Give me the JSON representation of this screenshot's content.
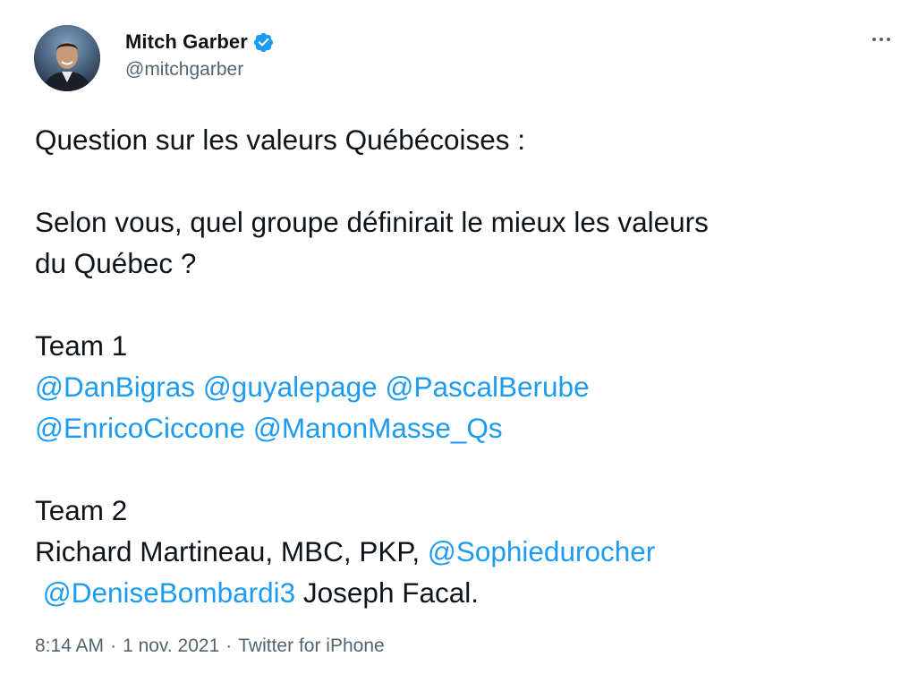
{
  "author": {
    "display_name": "Mitch Garber",
    "handle": "@mitchgarber",
    "verified": true
  },
  "tweet": {
    "line1": "Question sur les valeurs Québécoises :",
    "line2": "Selon vous, quel groupe définirait le mieux les valeurs",
    "line3": "du Québec ?",
    "team1_title": "Team 1",
    "team1_mentions_row1": [
      "@DanBigras",
      "@guyalepage",
      "@PascalBerube"
    ],
    "team1_mentions_row2": [
      "@EnricoCiccone",
      "@ManonMasse_Qs"
    ],
    "team2_title": "Team 2",
    "team2_row1_text": "Richard Martineau, MBC, PKP, ",
    "team2_row1_mention": "@Sophiedurocher",
    "team2_row2_mention": "@DeniseBombardi3",
    "team2_row2_text": " Joseph Facal."
  },
  "footer": {
    "time": "8:14 AM",
    "date": "1 nov. 2021",
    "source": "Twitter for iPhone",
    "separator": "·"
  },
  "icons": {
    "verified": "verified-badge-icon",
    "more": "more-options-icon"
  },
  "colors": {
    "link": "#1d9bf0",
    "text": "#0f1419",
    "secondary": "#536471",
    "verified": "#1d9bf0"
  }
}
